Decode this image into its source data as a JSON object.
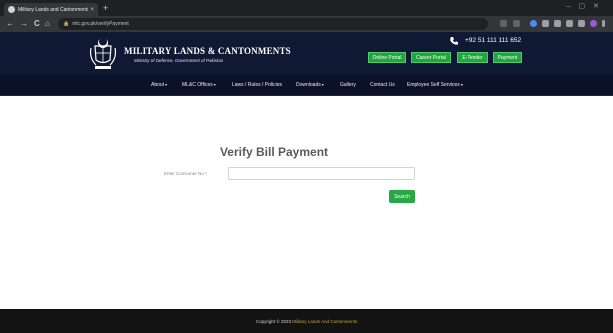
{
  "browser": {
    "tab_title": "Military Lands and Cantonments",
    "tab_close": "×",
    "new_tab": "+",
    "url": "mlc.gov.pk/verifyPayment",
    "nav": {
      "back": "←",
      "forward": "→",
      "reload": "C",
      "home": "⌂"
    }
  },
  "header": {
    "title": "MILITARY LANDS & CANTONMENTS",
    "subtitle": "Ministry of Defence, Government of Pakistan",
    "phone": "+92 51 111 111 652",
    "buttons": [
      "Online Portal",
      "Career Portal",
      "E-Tender",
      "Payment"
    ]
  },
  "menu": {
    "items": [
      "About",
      "ML&C Offices",
      "Laws / Rules / Policies",
      "Downloads",
      "Gallery",
      "Contact Us",
      "Employee Self Services"
    ]
  },
  "main": {
    "heading": "Verify Bill Payment",
    "consumer_label": "Enter Consumer No *",
    "search_label": "Search"
  },
  "footer": {
    "copyright_prefix": "Copyright © 2023",
    "copyright_brand": "Military Lands And Cantonments"
  },
  "colors": {
    "header_bg": "#0f1934",
    "navbar_bg": "#0b1128",
    "accent_green": "#28a745",
    "footer_bg": "#131313",
    "footer_brand": "#c7a23a"
  }
}
